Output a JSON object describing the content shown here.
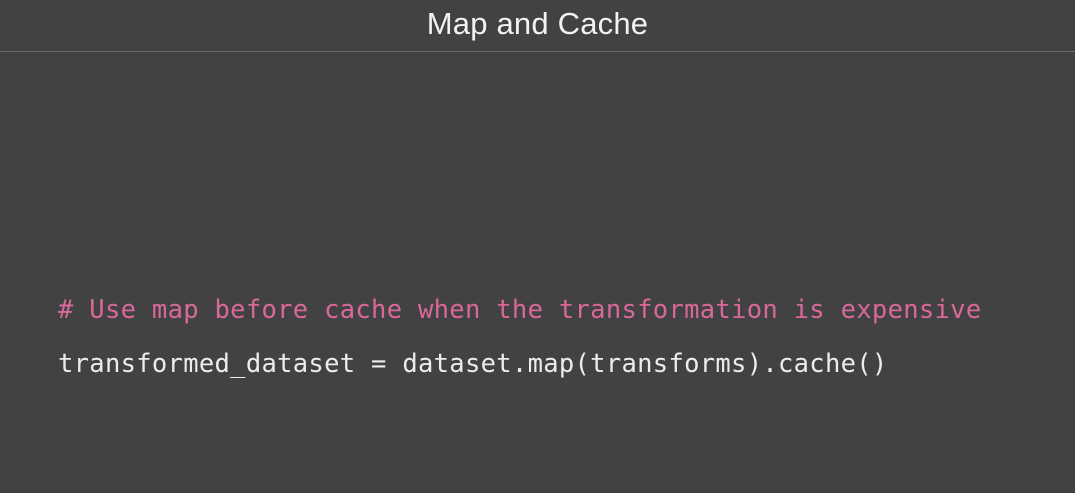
{
  "slide": {
    "title": "Map and Cache"
  },
  "code": {
    "comment": "# Use map before cache when the transformation is expensive",
    "statement": "transformed_dataset = dataset.map(transforms).cache()"
  },
  "colors": {
    "background": "#424242",
    "title_text": "#f2f2f2",
    "comment": "#d9689a",
    "code_text": "#ececec",
    "divider": "#6a6a6a"
  }
}
